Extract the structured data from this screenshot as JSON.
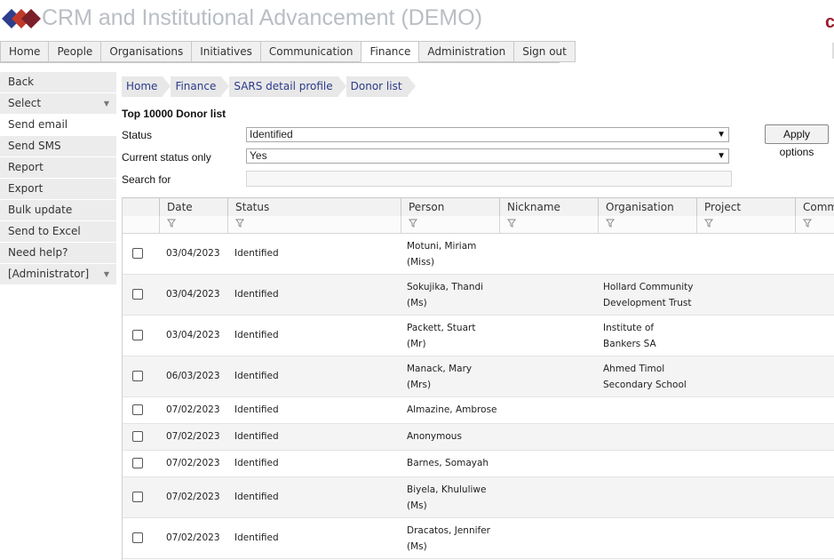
{
  "app": {
    "title": "CRM and Institutional Advancement (DEMO)",
    "corner_mark": "c",
    "brand_colors": [
      "#2c3e8c",
      "#c0392b",
      "#7b1f2a"
    ]
  },
  "topnav": [
    "Home",
    "People",
    "Organisations",
    "Initiatives",
    "Communication",
    "Finance",
    "Administration",
    "Sign out"
  ],
  "topnav_active": "Finance",
  "sidebar": [
    {
      "label": "Back"
    },
    {
      "label": "Select",
      "dropdown": true
    },
    {
      "label": "Send email",
      "active": true
    },
    {
      "label": "Send SMS"
    },
    {
      "label": "Report"
    },
    {
      "label": "Export"
    },
    {
      "label": "Bulk update"
    },
    {
      "label": "Send to Excel"
    },
    {
      "label": "Need help?"
    },
    {
      "label": "[Administrator]",
      "dropdown": true
    }
  ],
  "breadcrumb": [
    "Home",
    "Finance",
    "SARS detail profile",
    "Donor list"
  ],
  "list_title": "Top 10000 Donor list",
  "options": {
    "status_label": "Status",
    "status_value": "Identified",
    "current_label": "Current status only",
    "current_value": "Yes",
    "search_label": "Search for",
    "search_value": "",
    "apply_label": "Apply options"
  },
  "grid": {
    "columns": [
      "Date",
      "Status",
      "Person",
      "Nickname",
      "Organisation",
      "Project",
      "Comm"
    ],
    "rows": [
      {
        "date": "03/04/2023",
        "status": "Identified",
        "person": [
          "Motuni, Miriam",
          "(Miss)"
        ],
        "org": []
      },
      {
        "date": "03/04/2023",
        "status": "Identified",
        "person": [
          "Sokujika, Thandi",
          "(Ms)"
        ],
        "org": [
          "Hollard Community",
          "Development Trust"
        ]
      },
      {
        "date": "03/04/2023",
        "status": "Identified",
        "person": [
          "Packett, Stuart",
          "(Mr)"
        ],
        "org": [
          "Institute of",
          "Bankers SA"
        ]
      },
      {
        "date": "06/03/2023",
        "status": "Identified",
        "person": [
          "Manack, Mary",
          "(Mrs)"
        ],
        "org": [
          "Ahmed Timol",
          "Secondary School"
        ]
      },
      {
        "date": "07/02/2023",
        "status": "Identified",
        "person": [
          "Almazine, Ambrose"
        ],
        "org": []
      },
      {
        "date": "07/02/2023",
        "status": "Identified",
        "person": [
          "Anonymous"
        ],
        "org": []
      },
      {
        "date": "07/02/2023",
        "status": "Identified",
        "person": [
          "Barnes, Somayah"
        ],
        "org": []
      },
      {
        "date": "07/02/2023",
        "status": "Identified",
        "person": [
          "Biyela, Khululiwe",
          "(Ms)"
        ],
        "org": []
      },
      {
        "date": "07/02/2023",
        "status": "Identified",
        "person": [
          "Dracatos, Jennifer",
          "(Ms)"
        ],
        "org": []
      }
    ]
  }
}
